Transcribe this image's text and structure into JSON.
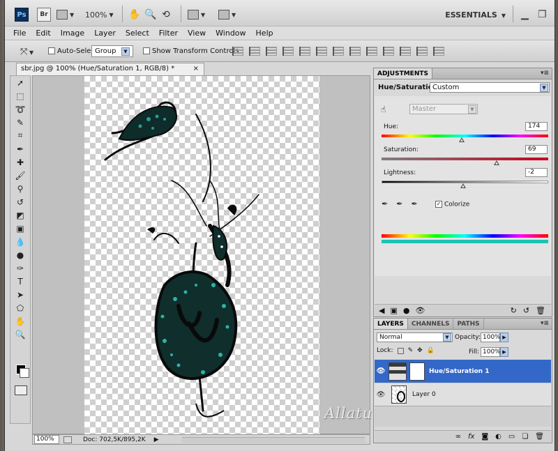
{
  "appbar": {
    "ps_logo": "Ps",
    "br_logo": "Br",
    "zoom": "100%",
    "workspace": "ESSENTIALS"
  },
  "menu": [
    "File",
    "Edit",
    "Image",
    "Layer",
    "Select",
    "Filter",
    "View",
    "Window",
    "Help"
  ],
  "options": {
    "auto_select_label": "Auto-Select:",
    "auto_select_value": "Group",
    "transform_label": "Show Transform Controls"
  },
  "document": {
    "tab_title": "sbr.jpg @ 100% (Hue/Saturation 1, RGB/8) *",
    "close": "×",
    "watermark": "Allaturkaa/GnL"
  },
  "status": {
    "zoom": "100%",
    "doc_info": "Doc: 702,5K/895,2K"
  },
  "adjustments": {
    "tab": "ADJUSTMENTS",
    "title": "Hue/Saturation",
    "preset": "Custom",
    "channel": "Master",
    "hue_label": "Hue:",
    "hue_value": "174",
    "hue_fraction": 0.483,
    "saturation_label": "Saturation:",
    "saturation_value": "69",
    "saturation_fraction": 0.69,
    "lightness_label": "Lightness:",
    "lightness_value": "-2",
    "lightness_fraction": 0.49,
    "colorize_label": "Colorize",
    "colorize_checked": true,
    "result_color": "#1ec2b4"
  },
  "layers": {
    "tabs": [
      "LAYERS",
      "CHANNELS",
      "PATHS"
    ],
    "blend_mode": "Normal",
    "opacity_label": "Opacity:",
    "opacity": "100%",
    "lock_label": "Lock:",
    "fill_label": "Fill:",
    "fill": "100%",
    "items": [
      {
        "name": "Hue/Saturation 1",
        "selected": true
      },
      {
        "name": "Layer 0",
        "selected": false
      }
    ]
  }
}
